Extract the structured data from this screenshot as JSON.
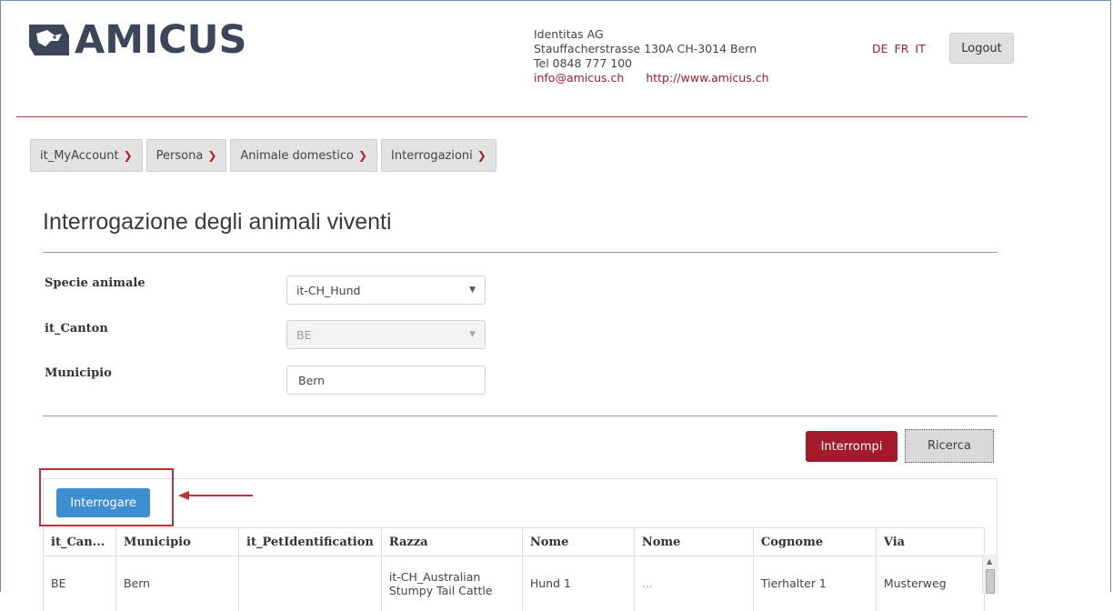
{
  "header": {
    "brand": "AMICUS",
    "contact": {
      "company": "Identitas AG",
      "address": "Stauffacherstrasse 130A CH-3014 Bern",
      "phone": "Tel 0848 777 100",
      "email": "info@amicus.ch",
      "website": "http://www.amicus.ch"
    },
    "languages": [
      "DE",
      "FR",
      "IT"
    ],
    "logout_label": "Logout"
  },
  "nav": [
    {
      "label": "it_MyAccount"
    },
    {
      "label": "Persona"
    },
    {
      "label": "Animale domestico"
    },
    {
      "label": "Interrogazioni"
    }
  ],
  "page_title": "Interrogazione degli animali viventi",
  "form": {
    "species_label": "Specie animale",
    "species_value": "it-CH_Hund",
    "canton_label": "it_Canton",
    "canton_value": "BE",
    "municipality_label": "Municipio",
    "municipality_value": "Bern"
  },
  "actions": {
    "abort_label": "Interrompi",
    "search_label": "Ricerca",
    "query_label": "Interrogare"
  },
  "table": {
    "columns": [
      "it_Can...",
      "Municipio",
      "it_PetIdentification",
      "Razza",
      "Nome",
      "Nome",
      "Cognome",
      "Via"
    ],
    "rows": [
      [
        "BE",
        "Bern",
        "",
        "it-CH_Australian Stumpy Tail Cattle",
        "Hund 1",
        "...",
        "Tierhalter 1",
        "Musterweg"
      ]
    ]
  },
  "colors": {
    "brand_red": "#a41a2a",
    "primary_blue": "#3d8fd2",
    "logo_dark": "#3b4758"
  }
}
